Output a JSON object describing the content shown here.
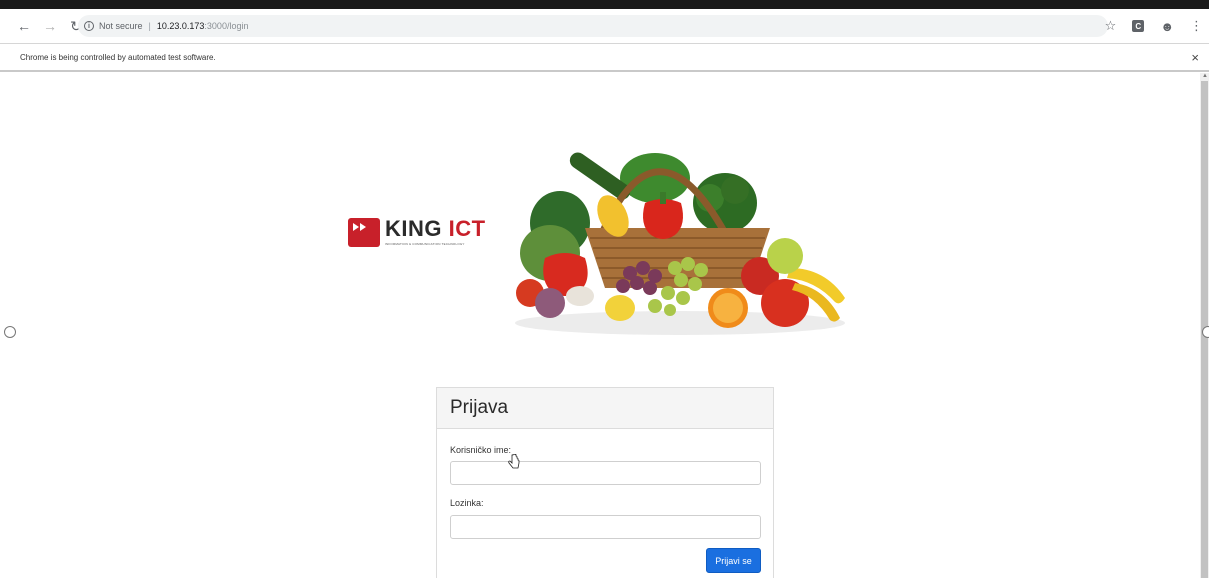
{
  "browser": {
    "address_security_label": "Not secure",
    "address_host": "10.23.0.173",
    "address_path": ":3000/login",
    "automation_notice": "Chrome is being controlled by automated test software."
  },
  "logo": {
    "name_part1": "KING",
    "name_part2": "ICT",
    "tagline": "INFORMATION & COMMUNICATION TECHNOLOGY"
  },
  "login": {
    "title": "Prijava",
    "username_label": "Korisničko ime:",
    "username_value": "",
    "password_label": "Lozinka:",
    "password_value": "",
    "submit_label": "Prijavi se"
  },
  "colors": {
    "brand_red": "#c8202a",
    "primary_button": "#1a6fe0"
  },
  "icons": [
    "back-icon",
    "forward-icon",
    "reload-icon",
    "info-icon",
    "star-icon",
    "extension-icon",
    "profile-icon",
    "menu-icon",
    "close-icon",
    "hand-cursor-icon"
  ]
}
